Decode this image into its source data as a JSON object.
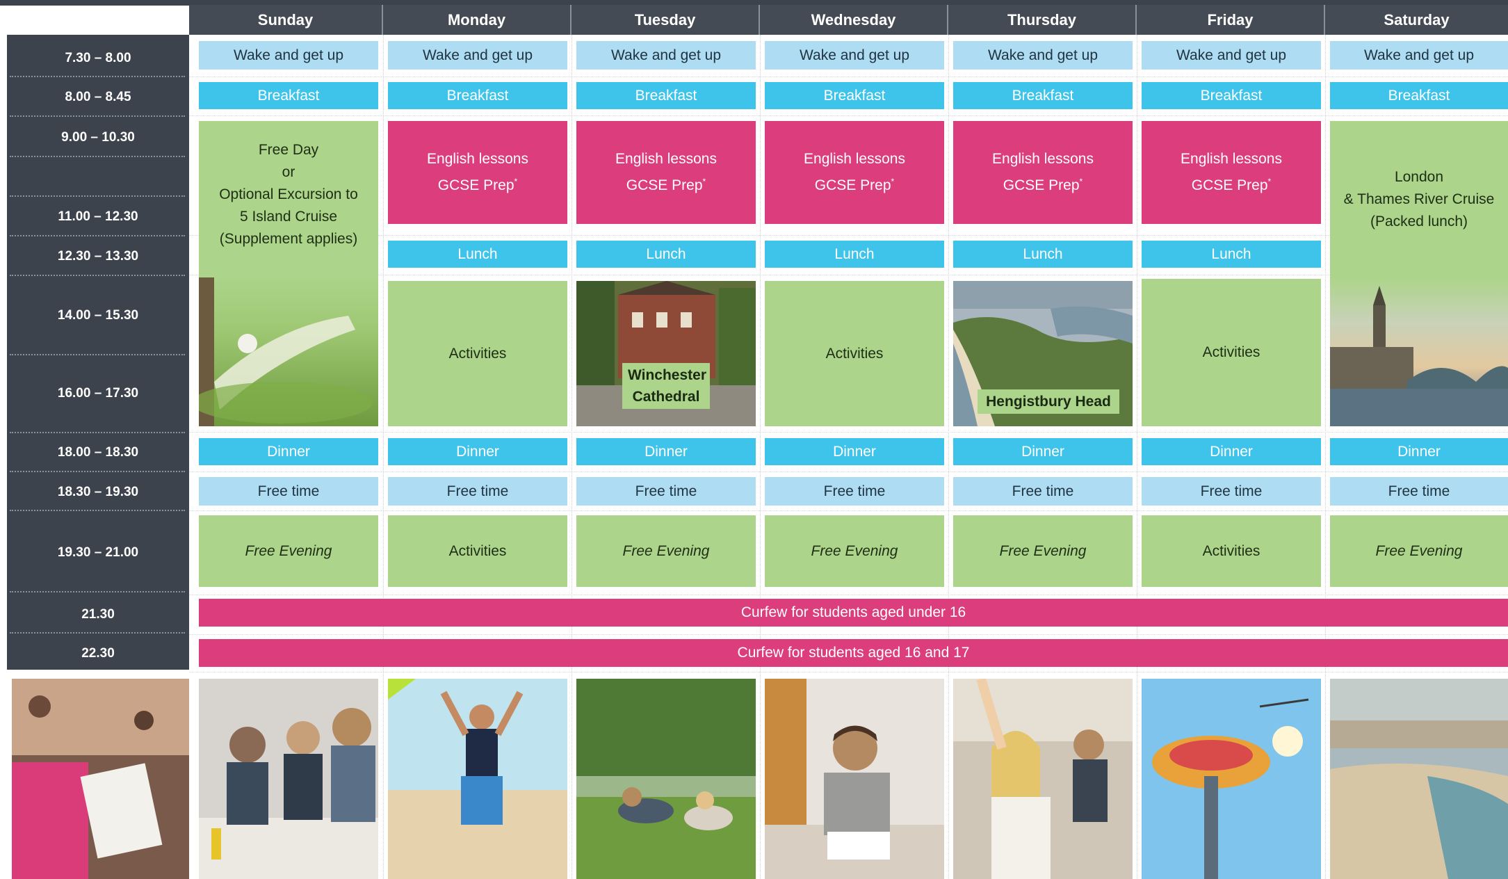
{
  "days": [
    "Sunday",
    "Monday",
    "Tuesday",
    "Wednesday",
    "Thursday",
    "Friday",
    "Saturday"
  ],
  "times": [
    "7.30 – 8.00",
    "8.00 – 8.45",
    "9.00 – 10.30",
    "11.00 – 12.30",
    "12.30 – 13.30",
    "14.00 – 15.30",
    "16.00 – 17.30",
    "18.00 – 18.30",
    "18.30 – 19.30",
    "19.30 – 21.00",
    "21.30",
    "22.30"
  ],
  "rows": {
    "wake": "Wake and get up",
    "breakfast": "Breakfast",
    "lunch": "Lunch",
    "dinner": "Dinner",
    "free_time": "Free time"
  },
  "sunday": {
    "line1": "Free Day",
    "line2": "or",
    "line3": "Optional Excursion to",
    "line4": "5 Island Cruise",
    "line5": "(Supplement applies)"
  },
  "lessons": {
    "line1": "English lessons",
    "line2": "GCSE Prep",
    "mark": "*"
  },
  "saturday": {
    "line1": "London",
    "line2": "& Thames River Cruise",
    "line3": "(Packed lunch)"
  },
  "afternoon": {
    "monday": "Activities",
    "tuesday_caption_1": "Winchester",
    "tuesday_caption_2": "Cathedral",
    "wednesday": "Activities",
    "thursday_caption": "Hengistbury Head",
    "friday": "Activities"
  },
  "evening": {
    "sunday": "Free Evening",
    "monday": "Activities",
    "tuesday": "Free Evening",
    "wednesday": "Free Evening",
    "thursday": "Free Evening",
    "friday": "Activities",
    "saturday": "Free Evening"
  },
  "curfew": {
    "under16": "Curfew for students aged under 16",
    "age16_17": "Curfew for students aged 16 and 17"
  },
  "colors": {
    "dark": "#3d434c",
    "light_blue": "#aedcf2",
    "blue": "#3ec4ea",
    "pink": "#db3d7d",
    "green": "#acd48a"
  }
}
